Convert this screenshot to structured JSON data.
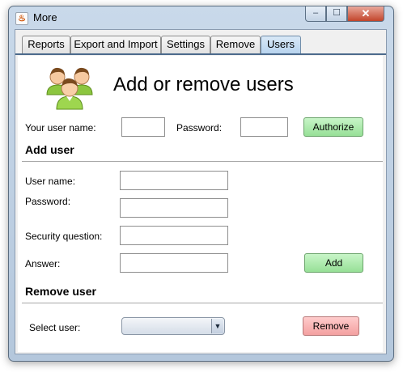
{
  "window": {
    "title": "More",
    "icon": "java-cup-icon"
  },
  "tabs": [
    {
      "label": "Reports"
    },
    {
      "label": "Export and Import"
    },
    {
      "label": "Settings"
    },
    {
      "label": "Remove"
    },
    {
      "label": "Users",
      "active": true
    }
  ],
  "panel": {
    "title": "Add or remove users",
    "icon": "users-group-icon",
    "auth": {
      "username_label": "Your user name:",
      "username_value": "",
      "password_label": "Password:",
      "password_value": "",
      "authorize_label": "Authorize"
    },
    "add_user": {
      "heading": "Add user",
      "username_label": "User name:",
      "password_label": "Password:",
      "security_question_label": "Security question:",
      "answer_label": "Answer:",
      "add_label": "Add"
    },
    "remove_user": {
      "heading": "Remove user",
      "select_label": "Select user:",
      "select_value": "",
      "remove_label": "Remove"
    }
  },
  "colors": {
    "authorize_button": "#a3e7a3",
    "add_button": "#a3e7a3",
    "remove_button": "#f7b3b3",
    "active_tab": "#c6ddf2"
  }
}
